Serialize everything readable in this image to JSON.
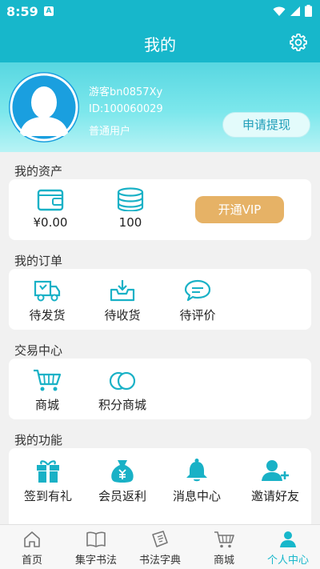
{
  "status_bar": {
    "time": "8:59",
    "notification_letter": "A"
  },
  "header": {
    "title": "我的",
    "settings_icon": "gear-icon"
  },
  "profile": {
    "nickname": "游客bn0857Xy",
    "user_id": "ID:100060029",
    "level": "普通用户",
    "withdraw_button": "申请提现"
  },
  "assets": {
    "title": "我的资产",
    "balance": "¥0.00",
    "points": "100",
    "vip_button": "开通VIP"
  },
  "orders": {
    "title": "我的订单",
    "items": [
      {
        "label": "待发货",
        "icon": "delivery-truck-icon"
      },
      {
        "label": "待收货",
        "icon": "inbox-download-icon"
      },
      {
        "label": "待评价",
        "icon": "comment-icon"
      }
    ]
  },
  "trade": {
    "title": "交易中心",
    "items": [
      {
        "label": "商城",
        "icon": "shopping-cart-icon"
      },
      {
        "label": "积分商城",
        "icon": "coins-icon"
      }
    ]
  },
  "functions": {
    "title": "我的功能",
    "items": [
      {
        "label": "签到有礼",
        "icon": "gift-icon"
      },
      {
        "label": "会员返利",
        "icon": "money-bag-icon"
      },
      {
        "label": "消息中心",
        "icon": "bell-icon"
      },
      {
        "label": "邀请好友",
        "icon": "add-user-icon"
      }
    ]
  },
  "bottom_nav": {
    "items": [
      {
        "label": "首页",
        "icon": "home-icon"
      },
      {
        "label": "集字书法",
        "icon": "book-icon"
      },
      {
        "label": "书法字典",
        "icon": "dictionary-icon"
      },
      {
        "label": "商城",
        "icon": "cart-icon"
      },
      {
        "label": "个人中心",
        "icon": "person-icon"
      }
    ],
    "active_index": 4
  },
  "colors": {
    "primary": "#17b7cb",
    "icon": "#19b1c6",
    "vip": "#e6b266",
    "nav_active": "#17b7cb"
  }
}
